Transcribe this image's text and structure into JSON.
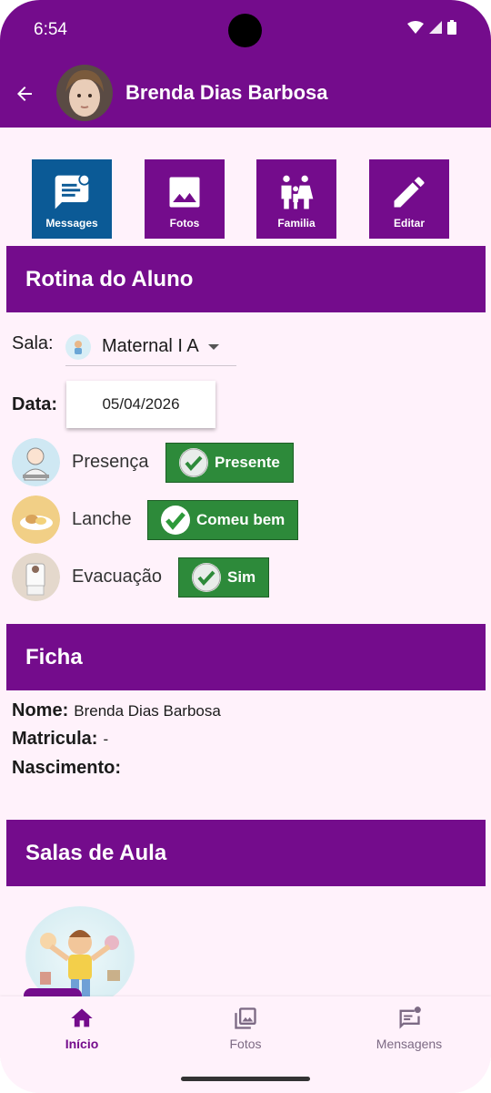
{
  "status_bar": {
    "time": "6:54"
  },
  "app_bar": {
    "title": "Brenda Dias Barbosa"
  },
  "actions": [
    {
      "label": "Messages",
      "icon": "message-icon",
      "active": true
    },
    {
      "label": "Fotos",
      "icon": "image-icon",
      "active": false
    },
    {
      "label": "Familia",
      "icon": "family-icon",
      "active": false
    },
    {
      "label": "Editar",
      "icon": "edit-icon",
      "active": false
    }
  ],
  "rotina": {
    "header": "Rotina do Aluno",
    "sala_label": "Sala:",
    "sala_value": "Maternal I A",
    "data_label": "Data:",
    "data_value": "05/04/2026",
    "items": [
      {
        "label": "Presença",
        "status": "Presente"
      },
      {
        "label": "Lanche",
        "status": "Comeu bem"
      },
      {
        "label": "Evacuação",
        "status": "Sim"
      }
    ]
  },
  "ficha": {
    "header": "Ficha",
    "nome_label": "Nome:",
    "nome_value": "Brenda Dias Barbosa",
    "matricula_label": "Matricula:",
    "matricula_value": "-",
    "nascimento_label": "Nascimento:",
    "nascimento_value": ""
  },
  "salas": {
    "header": "Salas de Aula"
  },
  "bottom_nav": [
    {
      "label": "Início",
      "icon": "home-icon",
      "active": true
    },
    {
      "label": "Fotos",
      "icon": "photos-icon",
      "active": false
    },
    {
      "label": "Mensagens",
      "icon": "chat-icon",
      "active": false
    }
  ],
  "colors": {
    "primary": "#740c8c",
    "active_tile": "#0b5a96",
    "success": "#2d8a3a",
    "background": "#fff2fb"
  }
}
